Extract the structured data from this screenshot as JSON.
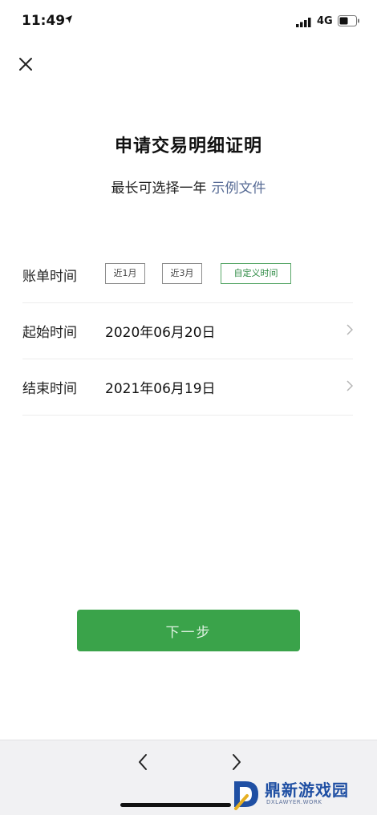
{
  "status_bar": {
    "time": "11:49",
    "network": "4G",
    "icons": [
      "location-arrow-icon",
      "signal-icon",
      "battery-icon"
    ]
  },
  "header": {
    "close_icon": "close-icon"
  },
  "main": {
    "title": "申请交易明细证明",
    "subtitle": "最长可选择一年",
    "sample_link": "示例文件",
    "bill_time": {
      "label": "账单时间",
      "options": [
        "近1月",
        "近3月",
        "自定义时间"
      ],
      "selected_index": 2
    },
    "start_time": {
      "label": "起始时间",
      "value": "2020年06月20日",
      "icon": "chevron-right-icon"
    },
    "end_time": {
      "label": "结束时间",
      "value": "2021年06月19日",
      "icon": "chevron-right-icon"
    },
    "next_button": "下一步"
  },
  "bottom_nav": {
    "back_icon": "chevron-left-icon",
    "forward_icon": "chevron-right-icon"
  },
  "watermark": {
    "title": "鼎新游戏园",
    "subtitle": "DXLAWYER.WORK"
  },
  "colors": {
    "accent_green": "#3aa34a",
    "link_blue": "#576b95",
    "selected_chip_green": "#2e8b44"
  }
}
